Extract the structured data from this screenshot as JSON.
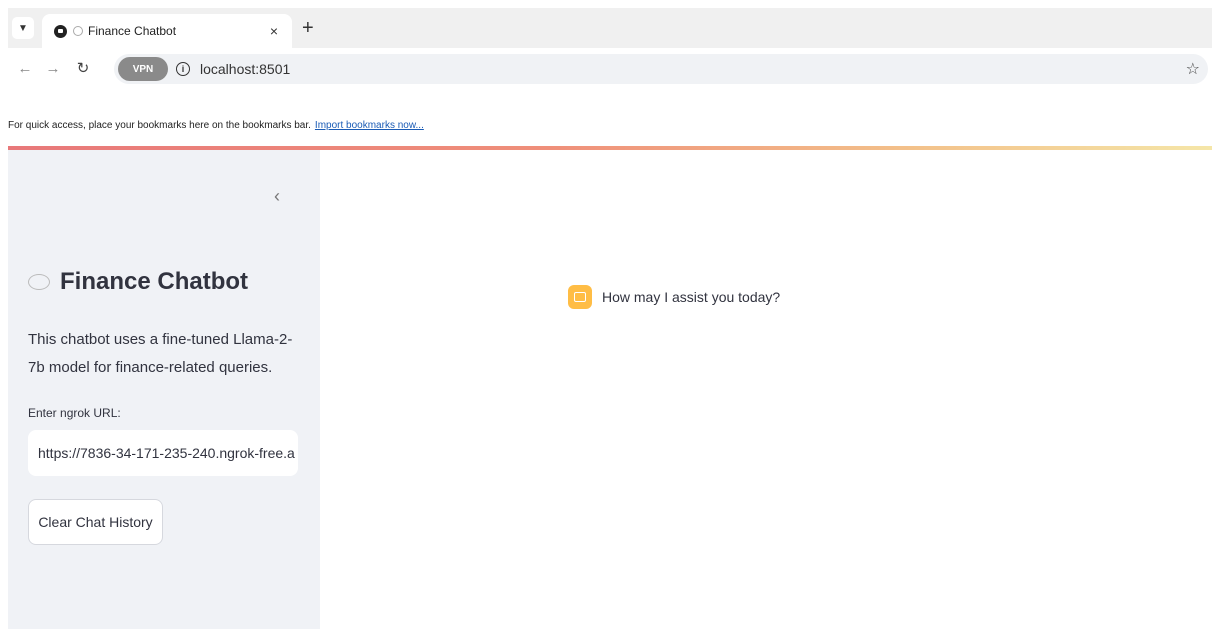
{
  "browser": {
    "tab_title": "Finance Chatbot",
    "tab_close": "×",
    "new_tab": "+",
    "tab_menu_icon": "chevron-down-icon",
    "url": "localhost:8501",
    "vpn_label": "VPN",
    "bookmarks_bar_text": "For quick access, place your bookmarks here on the bookmarks bar.",
    "bookmarks_link": "Import bookmarks now..."
  },
  "sidebar": {
    "collapse_glyph": "‹",
    "title": "Finance Chatbot",
    "description": "This chatbot uses a fine-tuned Llama-2-7b model for finance-related queries.",
    "ngrok_label": "Enter ngrok URL:",
    "ngrok_value": "https://7836-34-171-235-240.ngrok-free.a",
    "clear_button": "Clear Chat History"
  },
  "chat": {
    "assistant_message": "How may I assist you today?",
    "assistant_avatar_color": "#ffbd45"
  },
  "colors": {
    "sidebar_bg": "#f0f2f6",
    "text": "#31333f"
  }
}
